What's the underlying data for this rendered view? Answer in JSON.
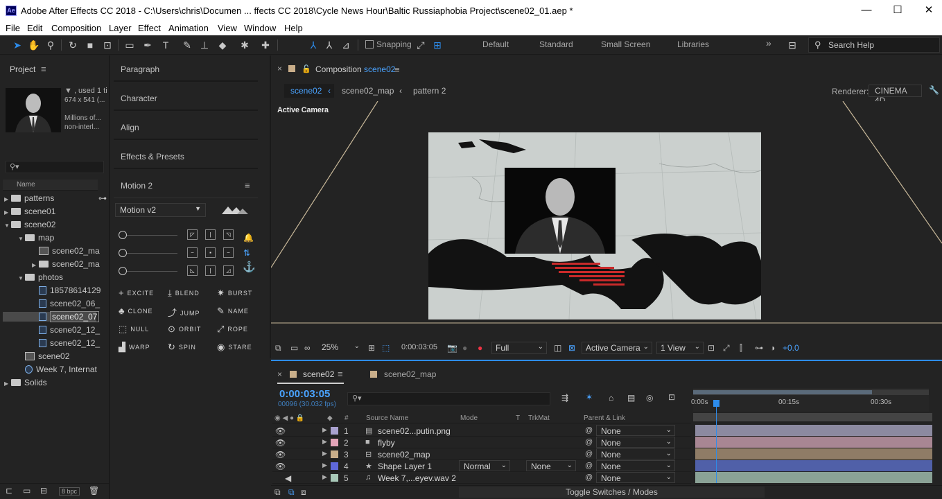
{
  "window": {
    "title": "Adobe After Effects CC 2018 - C:\\Users\\chris\\Documen ... ffects CC 2018\\Cycle News Hour\\Baltic Russiaphobia Project\\scene02_01.aep *",
    "logo": "Ae"
  },
  "menu": [
    "File",
    "Edit",
    "Composition",
    "Layer",
    "Effect",
    "Animation",
    "View",
    "Window",
    "Help"
  ],
  "toolbar": {
    "snapping_label": "Snapping",
    "workspaces": [
      "Default",
      "Standard",
      "Small Screen",
      "Libraries"
    ],
    "search_help": "Search Help",
    "more": "»"
  },
  "project": {
    "title": "Project",
    "thumb_meta": [
      "▼ , used 1 ti",
      "674 x 541 (...",
      "Millions of...",
      "non-interl..."
    ],
    "col_name": "Name",
    "tree": [
      {
        "label": "patterns",
        "type": "folder",
        "depth": 0,
        "open": false
      },
      {
        "label": "scene01",
        "type": "folder",
        "depth": 0,
        "open": false
      },
      {
        "label": "scene02",
        "type": "folder",
        "depth": 0,
        "open": true
      },
      {
        "label": "map",
        "type": "folder",
        "depth": 1,
        "open": true
      },
      {
        "label": "scene02_ma",
        "type": "comp",
        "depth": 2
      },
      {
        "label": "scene02_ma",
        "type": "folder",
        "depth": 2,
        "open": false
      },
      {
        "label": "photos",
        "type": "folder",
        "depth": 1,
        "open": true
      },
      {
        "label": "18578614129",
        "type": "file",
        "depth": 2
      },
      {
        "label": "scene02_06_",
        "type": "file",
        "depth": 2
      },
      {
        "label": "scene02_07",
        "type": "file",
        "depth": 2,
        "selected": true
      },
      {
        "label": "scene02_12_",
        "type": "file",
        "depth": 2
      },
      {
        "label": "scene02_12_",
        "type": "file",
        "depth": 2
      },
      {
        "label": "scene02",
        "type": "comp",
        "depth": 1
      },
      {
        "label": "Week 7, Internat",
        "type": "audio",
        "depth": 1
      },
      {
        "label": "Solids",
        "type": "folder",
        "depth": 0,
        "open": false
      }
    ],
    "bpc": "8 bpc"
  },
  "panels": {
    "paragraph": "Paragraph",
    "character": "Character",
    "align": "Align",
    "effects": "Effects & Presets",
    "motion": "Motion 2"
  },
  "motion": {
    "preset": "Motion v2",
    "buttons": [
      [
        "EXCITE",
        "BLEND",
        "BURST"
      ],
      [
        "CLONE",
        "JUMP",
        "NAME"
      ],
      [
        "NULL",
        "ORBIT",
        "ROPE"
      ],
      [
        "WARP",
        "SPIN",
        "STARE"
      ]
    ]
  },
  "composition": {
    "tab_prefix": "Composition",
    "tab_name": "scene02",
    "crumbs": [
      "scene02",
      "scene02_map",
      "pattern 2"
    ],
    "renderer_label": "Renderer:",
    "renderer": "CINEMA 4D",
    "camera_label": "Active Camera",
    "zoom": "25%",
    "timecode": "0:00:03:05",
    "resolution": "Full",
    "camera_select": "Active Camera",
    "views": "1 View",
    "exposure": "+0.0"
  },
  "timeline": {
    "tabs": [
      "scene02",
      "scene02_map"
    ],
    "timecode": "0:00:03:05",
    "fps": "00096 (30.032 fps)",
    "columns": {
      "source": "Source Name",
      "mode": "Mode",
      "t": "T",
      "trkmat": "TrkMat",
      "parent": "Parent & Link"
    },
    "ruler": [
      "0:00s",
      "00:15s",
      "00:30s"
    ],
    "layers": [
      {
        "idx": "1",
        "name": "scene02...putin.png",
        "color": "#a9a1cf",
        "bar": "#8c8aa0",
        "parent": "None"
      },
      {
        "idx": "2",
        "name": "flyby",
        "color": "#e3a4b8",
        "bar": "#a88693",
        "parent": "None"
      },
      {
        "idx": "3",
        "name": "scene02_map",
        "color": "#c9ae8a",
        "bar": "#8f7c66",
        "parent": "None"
      },
      {
        "idx": "4",
        "name": "Shape Layer 1",
        "color": "#5f68d9",
        "bar": "#5060a8",
        "mode": "Normal",
        "trkmat": "None",
        "parent": "None"
      },
      {
        "idx": "5",
        "name": "Week 7,...eyev.wav 2",
        "color": "#a8c8b8",
        "bar": "#8aa296",
        "parent": "None"
      }
    ],
    "toggle": "Toggle Switches / Modes"
  }
}
